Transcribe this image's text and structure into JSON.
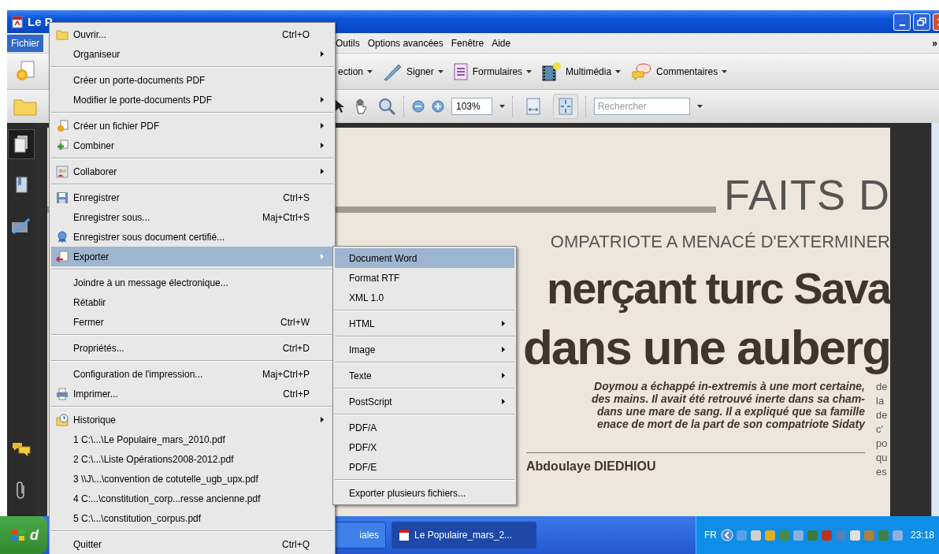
{
  "window": {
    "title": "Le P"
  },
  "menu_bar": [
    {
      "label": "Fichier",
      "selected": true
    },
    {
      "label": "Outils",
      "selected": false
    },
    {
      "label": "Options avancées",
      "selected": false
    },
    {
      "label": "Fenêtre",
      "selected": false
    },
    {
      "label": "Aide",
      "selected": false
    }
  ],
  "menu_bar_overflow": "»",
  "toolbar_1": [
    {
      "label": "ection"
    },
    {
      "label": "Signer"
    },
    {
      "label": "Formulaires"
    },
    {
      "label": "Multimédia"
    },
    {
      "label": "Commentaires"
    }
  ],
  "toolbar_2": {
    "zoom": "103%",
    "fit_page": {
      "selected": true
    },
    "search": {
      "placeholder": "Rechercher"
    }
  },
  "sidebar": [
    {
      "selected": true
    },
    {
      "selected": false
    },
    {
      "selected": false
    },
    {
      "selected": false
    },
    {
      "selected": false
    }
  ],
  "file_menu": [
    {
      "kind": "item",
      "label": "Ouvrir...",
      "shortcut": "Ctrl+O",
      "submenu": false,
      "selected": false
    },
    {
      "kind": "item",
      "label": "Organiseur",
      "submenu": true,
      "selected": false
    },
    {
      "kind": "separator"
    },
    {
      "kind": "item",
      "label": "Créer un porte-documents PDF",
      "submenu": false,
      "selected": false
    },
    {
      "kind": "item",
      "label": "Modifier le porte-documents PDF",
      "submenu": true,
      "selected": false
    },
    {
      "kind": "separator"
    },
    {
      "kind": "item",
      "label": "Créer un fichier PDF",
      "submenu": true,
      "selected": false
    },
    {
      "kind": "item",
      "label": "Combiner",
      "submenu": true,
      "selected": false
    },
    {
      "kind": "separator"
    },
    {
      "kind": "item",
      "label": "Collaborer",
      "submenu": true,
      "selected": false
    },
    {
      "kind": "separator"
    },
    {
      "kind": "item",
      "label": "Enregistrer",
      "shortcut": "Ctrl+S",
      "submenu": false,
      "selected": false
    },
    {
      "kind": "item",
      "label": "Enregistrer sous...",
      "shortcut": "Maj+Ctrl+S",
      "submenu": false,
      "selected": false
    },
    {
      "kind": "item",
      "label": "Enregistrer sous document certifié...",
      "submenu": false,
      "selected": false
    },
    {
      "kind": "item",
      "label": "Exporter",
      "submenu": true,
      "selected": true
    },
    {
      "kind": "separator"
    },
    {
      "kind": "item",
      "label": "Joindre à un message électronique...",
      "submenu": false,
      "selected": false
    },
    {
      "kind": "item",
      "label": "Rétablir",
      "submenu": false,
      "selected": false
    },
    {
      "kind": "item",
      "label": "Fermer",
      "shortcut": "Ctrl+W",
      "submenu": false,
      "selected": false
    },
    {
      "kind": "separator"
    },
    {
      "kind": "item",
      "label": "Propriétés...",
      "shortcut": "Ctrl+D",
      "submenu": false,
      "selected": false
    },
    {
      "kind": "separator"
    },
    {
      "kind": "item",
      "label": "Configuration de l'impression...",
      "shortcut": "Maj+Ctrl+P",
      "submenu": false,
      "selected": false
    },
    {
      "kind": "item",
      "label": "Imprimer...",
      "shortcut": "Ctrl+P",
      "submenu": false,
      "selected": false
    },
    {
      "kind": "separator"
    },
    {
      "kind": "item",
      "label": "Historique",
      "submenu": true,
      "selected": false
    },
    {
      "kind": "item",
      "label": "1 C:\\...\\Le Populaire_mars_2010.pdf",
      "submenu": false,
      "selected": false
    },
    {
      "kind": "item",
      "label": "2 C:\\...\\Liste Opérations2008-2012.pdf",
      "submenu": false,
      "selected": false
    },
    {
      "kind": "item",
      "label": "3 \\\\J\\...\\convention de cotutelle_ugb_upx.pdf",
      "submenu": false,
      "selected": false
    },
    {
      "kind": "item",
      "label": "4 C:...\\constitution_corp...resse ancienne.pdf",
      "submenu": false,
      "selected": false
    },
    {
      "kind": "item",
      "label": "5 C:\\...\\constitution_corpus.pdf",
      "submenu": false,
      "selected": false
    },
    {
      "kind": "separator"
    },
    {
      "kind": "item",
      "label": "Quitter",
      "shortcut": "Ctrl+Q",
      "submenu": false,
      "selected": false
    }
  ],
  "export_submenu": [
    {
      "kind": "item",
      "label": "Document Word",
      "submenu": false,
      "selected": true
    },
    {
      "kind": "item",
      "label": "Format RTF",
      "submenu": false,
      "selected": false
    },
    {
      "kind": "item",
      "label": "XML 1.0",
      "submenu": false,
      "selected": false
    },
    {
      "kind": "separator"
    },
    {
      "kind": "item",
      "label": "HTML",
      "submenu": true,
      "selected": false
    },
    {
      "kind": "separator"
    },
    {
      "kind": "item",
      "label": "Image",
      "submenu": true,
      "selected": false
    },
    {
      "kind": "separator"
    },
    {
      "kind": "item",
      "label": "Texte",
      "submenu": true,
      "selected": false
    },
    {
      "kind": "separator"
    },
    {
      "kind": "item",
      "label": "PostScript",
      "submenu": true,
      "selected": false
    },
    {
      "kind": "separator"
    },
    {
      "kind": "item",
      "label": "PDF/A",
      "submenu": false,
      "selected": false
    },
    {
      "kind": "item",
      "label": "PDF/X",
      "submenu": false,
      "selected": false
    },
    {
      "kind": "item",
      "label": "PDF/E",
      "submenu": false,
      "selected": false
    },
    {
      "kind": "separator"
    },
    {
      "kind": "item",
      "label": "Exporter plusieurs fichiers...",
      "submenu": false,
      "selected": false
    }
  ],
  "document": {
    "section_title": "FAITS D",
    "kicker": "OMPATRIOTE A MENACÉ D'EXTERMINER",
    "headline": [
      "nerçant turc Sava",
      "dans une auberg"
    ],
    "lead": [
      "Doymou a échappé in-extremis à une mort certaine,",
      "des mains. Il avait été retrouvé inerte dans sa cham-",
      "dans une mare de sang. Il a expliqué que sa famille",
      "enace de mort de la part de son compatriote Sidaty"
    ],
    "byline": "Abdoulaye DIEDHIOU",
    "column_2": [
      "de",
      "la",
      "de",
      "c'",
      "po",
      "qu",
      "es"
    ]
  },
  "taskbar": {
    "start": "d",
    "tasks": [
      {
        "label": "iales",
        "selected": false
      },
      {
        "label": "Le Populaire_mars_2...",
        "selected": true
      }
    ],
    "language": "FR",
    "clock": "23:18"
  }
}
